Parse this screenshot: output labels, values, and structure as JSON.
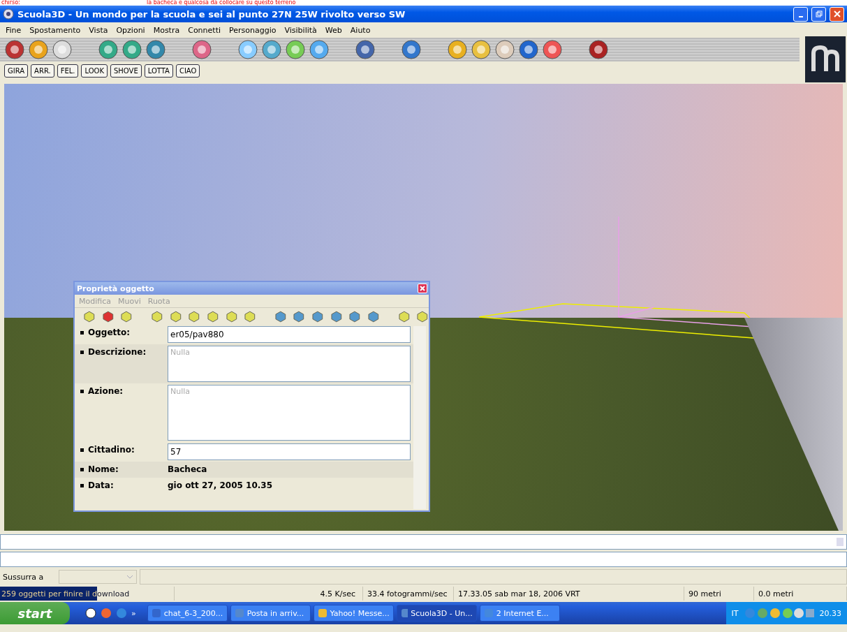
{
  "note": {
    "left": "chirso:",
    "right": "la bacheca e qualcosa da collocare su questo terreno"
  },
  "window": {
    "title": "Scuola3D - Un mondo per la scuola e sei al punto 27N 25W rivolto verso SW"
  },
  "menu": [
    "Fine",
    "Spostamento",
    "Vista",
    "Opzioni",
    "Mostra",
    "Connetti",
    "Personaggio",
    "Visibilità",
    "Web",
    "Aiuto"
  ],
  "action_buttons": [
    "GIRA",
    "ARR.",
    "FEL.",
    "LOOK",
    "SHOVE",
    "LOTTA",
    "CIAO"
  ],
  "dialog": {
    "title": "Proprietà oggetto",
    "menu": [
      "Modifica",
      "Muovi",
      "Ruota"
    ],
    "fields": [
      {
        "kind": "input",
        "label": "Oggetto:",
        "value": "er05/pav880"
      },
      {
        "kind": "textarea",
        "label": "Descrizione:",
        "placeholder": "Nulla"
      },
      {
        "kind": "textarea_tall",
        "label": "Azione:",
        "placeholder": "Nulla"
      },
      {
        "kind": "input",
        "label": "Cittadino:",
        "value": "57"
      },
      {
        "kind": "text",
        "label": "Nome:",
        "value": "Bacheca"
      },
      {
        "kind": "text",
        "label": "Data:",
        "value": "gio ott 27, 2005 10.35"
      }
    ]
  },
  "whisper": {
    "label": "Sussurra a"
  },
  "status_bar": {
    "progress": {
      "text": "259 oggetti per finire il download",
      "level": 0.56
    },
    "cells": [
      "4.5 K/sec",
      "33.4 fotogrammi/sec",
      "17.33.05 sab mar 18, 2006 VRT",
      "90 metri",
      "0.0 metri"
    ]
  },
  "taskbar": {
    "start": "start",
    "more": "»",
    "tasks": [
      {
        "label": "chat_6-3_200...",
        "selected": false
      },
      {
        "label": "Posta in arriv...",
        "selected": false
      },
      {
        "label": "Yahoo! Messe...",
        "selected": false
      },
      {
        "label": "Scuola3D - Un...",
        "selected": true
      },
      {
        "label": "2 Internet E...",
        "selected": false
      }
    ],
    "language": "IT",
    "clock": "20.33"
  }
}
